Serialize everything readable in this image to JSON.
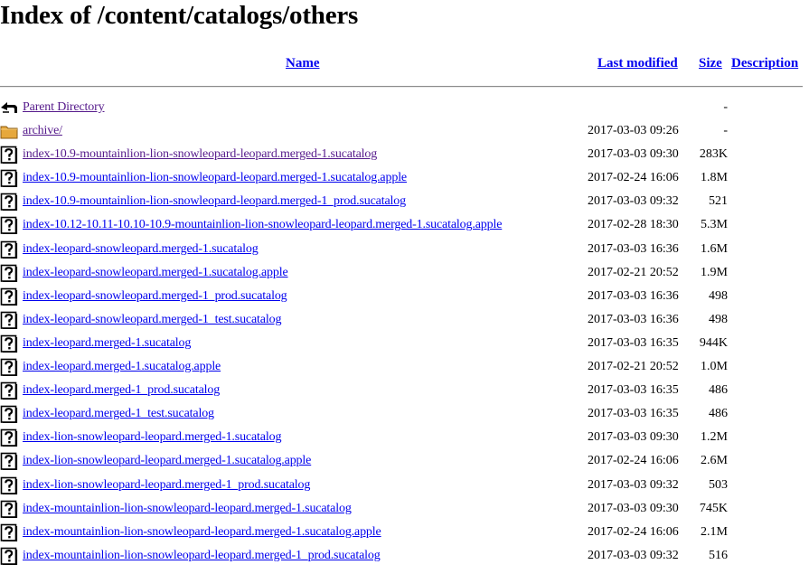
{
  "page": {
    "title": "Index of /content/catalogs/others"
  },
  "columns": {
    "name": "Name",
    "last_modified": "Last modified",
    "size": "Size",
    "description": "Description"
  },
  "entries": [
    {
      "icon": "back-icon",
      "name": "Parent Directory",
      "date": "",
      "size": "-",
      "visited": true
    },
    {
      "icon": "folder-icon",
      "name": "archive/",
      "date": "2017-03-03 09:26",
      "size": "-",
      "visited": true
    },
    {
      "icon": "unknown-file-icon",
      "name": "index-10.9-mountainlion-lion-snowleopard-leopard.merged-1.sucatalog",
      "date": "2017-03-03 09:30",
      "size": "283K",
      "visited": true
    },
    {
      "icon": "unknown-file-icon",
      "name": "index-10.9-mountainlion-lion-snowleopard-leopard.merged-1.sucatalog.apple",
      "date": "2017-02-24 16:06",
      "size": "1.8M",
      "visited": false
    },
    {
      "icon": "unknown-file-icon",
      "name": "index-10.9-mountainlion-lion-snowleopard-leopard.merged-1_prod.sucatalog",
      "date": "2017-03-03 09:32",
      "size": "521",
      "visited": false
    },
    {
      "icon": "unknown-file-icon",
      "name": "index-10.12-10.11-10.10-10.9-mountainlion-lion-snowleopard-leopard.merged-1.sucatalog.apple",
      "date": "2017-02-28 18:30",
      "size": "5.3M",
      "visited": false
    },
    {
      "icon": "unknown-file-icon",
      "name": "index-leopard-snowleopard.merged-1.sucatalog",
      "date": "2017-03-03 16:36",
      "size": "1.6M",
      "visited": false
    },
    {
      "icon": "unknown-file-icon",
      "name": "index-leopard-snowleopard.merged-1.sucatalog.apple",
      "date": "2017-02-21 20:52",
      "size": "1.9M",
      "visited": false
    },
    {
      "icon": "unknown-file-icon",
      "name": "index-leopard-snowleopard.merged-1_prod.sucatalog",
      "date": "2017-03-03 16:36",
      "size": "498",
      "visited": false
    },
    {
      "icon": "unknown-file-icon",
      "name": "index-leopard-snowleopard.merged-1_test.sucatalog",
      "date": "2017-03-03 16:36",
      "size": "498",
      "visited": false
    },
    {
      "icon": "unknown-file-icon",
      "name": "index-leopard.merged-1.sucatalog",
      "date": "2017-03-03 16:35",
      "size": "944K",
      "visited": false
    },
    {
      "icon": "unknown-file-icon",
      "name": "index-leopard.merged-1.sucatalog.apple",
      "date": "2017-02-21 20:52",
      "size": "1.0M",
      "visited": false
    },
    {
      "icon": "unknown-file-icon",
      "name": "index-leopard.merged-1_prod.sucatalog",
      "date": "2017-03-03 16:35",
      "size": "486",
      "visited": false
    },
    {
      "icon": "unknown-file-icon",
      "name": "index-leopard.merged-1_test.sucatalog",
      "date": "2017-03-03 16:35",
      "size": "486",
      "visited": false
    },
    {
      "icon": "unknown-file-icon",
      "name": "index-lion-snowleopard-leopard.merged-1.sucatalog",
      "date": "2017-03-03 09:30",
      "size": "1.2M",
      "visited": false
    },
    {
      "icon": "unknown-file-icon",
      "name": "index-lion-snowleopard-leopard.merged-1.sucatalog.apple",
      "date": "2017-02-24 16:06",
      "size": "2.6M",
      "visited": false
    },
    {
      "icon": "unknown-file-icon",
      "name": "index-lion-snowleopard-leopard.merged-1_prod.sucatalog",
      "date": "2017-03-03 09:32",
      "size": "503",
      "visited": false
    },
    {
      "icon": "unknown-file-icon",
      "name": "index-mountainlion-lion-snowleopard-leopard.merged-1.sucatalog",
      "date": "2017-03-03 09:30",
      "size": "745K",
      "visited": false
    },
    {
      "icon": "unknown-file-icon",
      "name": "index-mountainlion-lion-snowleopard-leopard.merged-1.sucatalog.apple",
      "date": "2017-02-24 16:06",
      "size": "2.1M",
      "visited": false
    },
    {
      "icon": "unknown-file-icon",
      "name": "index-mountainlion-lion-snowleopard-leopard.merged-1_prod.sucatalog",
      "date": "2017-03-03 09:32",
      "size": "516",
      "visited": false
    }
  ],
  "colors": {
    "link": "#0000ee",
    "visited_link": "#551a8b",
    "folder": "#e6a83c"
  }
}
